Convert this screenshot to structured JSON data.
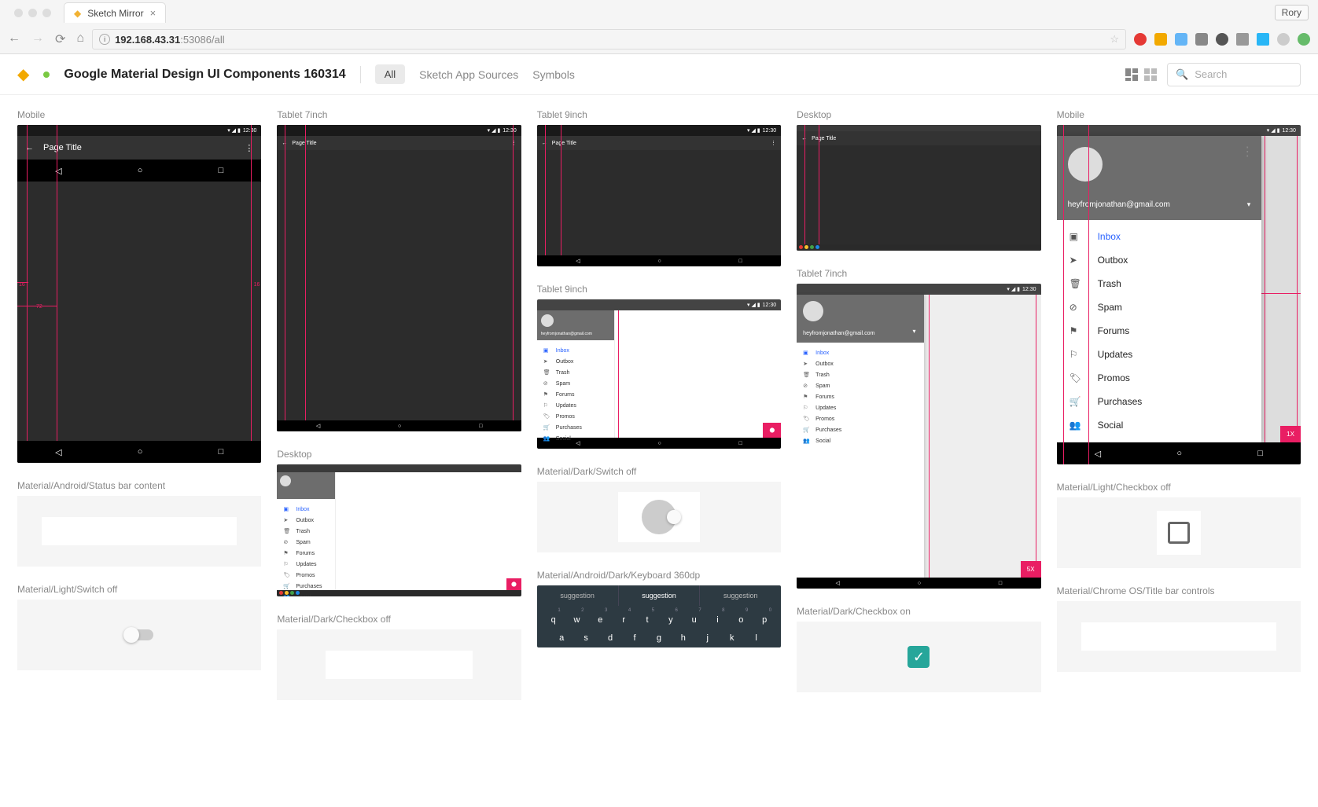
{
  "browser": {
    "tab_title": "Sketch Mirror",
    "user_name": "Rory",
    "url_host": "192.168.43.31",
    "url_path": ":53086/all"
  },
  "header": {
    "doc_title": "Google Material Design UI Components 160314",
    "filter_all": "All",
    "link_sources": "Sketch App Sources",
    "link_symbols": "Symbols",
    "search_placeholder": "Search"
  },
  "status_time": "12:30",
  "page_title": "Page Title",
  "drawer": {
    "email": "heyfromjonathan@gmail.com",
    "items": [
      {
        "icon": "inbox",
        "label": "Inbox",
        "active": true
      },
      {
        "icon": "send",
        "label": "Outbox"
      },
      {
        "icon": "trash",
        "label": "Trash"
      },
      {
        "icon": "spam",
        "label": "Spam"
      },
      {
        "icon": "forum",
        "label": "Forums"
      },
      {
        "icon": "flag",
        "label": "Updates"
      },
      {
        "icon": "tag",
        "label": "Promos"
      },
      {
        "icon": "cart",
        "label": "Purchases"
      },
      {
        "icon": "people",
        "label": "Social"
      }
    ]
  },
  "fab_label": "1X",
  "fab_label_5x": "5X",
  "keyboard": {
    "suggestions": [
      "suggestion",
      "suggestion",
      "suggestion"
    ],
    "row1": [
      {
        "k": "q",
        "n": "1"
      },
      {
        "k": "w",
        "n": "2"
      },
      {
        "k": "e",
        "n": "3"
      },
      {
        "k": "r",
        "n": "4"
      },
      {
        "k": "t",
        "n": "5"
      },
      {
        "k": "y",
        "n": "6"
      },
      {
        "k": "u",
        "n": "7"
      },
      {
        "k": "i",
        "n": "8"
      },
      {
        "k": "o",
        "n": "9"
      },
      {
        "k": "p",
        "n": "0"
      }
    ],
    "row2": [
      "a",
      "s",
      "d",
      "f",
      "g",
      "h",
      "j",
      "k",
      "l"
    ]
  },
  "artboards": {
    "mobile": "Mobile",
    "tablet7": "Tablet 7inch",
    "tablet9": "Tablet 9inch",
    "desktop": "Desktop",
    "status_bar": "Material/Android/Status bar content",
    "switch_light_off": "Material/Light/Switch off",
    "checkbox_dark_off": "Material/Dark/Checkbox off",
    "switch_dark_off": "Material/Dark/Switch off",
    "keyboard": "Material/Android/Dark/Keyboard 360dp",
    "checkbox_dark_on": "Material/Dark/Checkbox on",
    "checkbox_light_off": "Material/Light/Checkbox off",
    "titlebar": "Material/Chrome OS/Title bar controls"
  },
  "guides": {
    "m16": "16",
    "m72": "72"
  }
}
